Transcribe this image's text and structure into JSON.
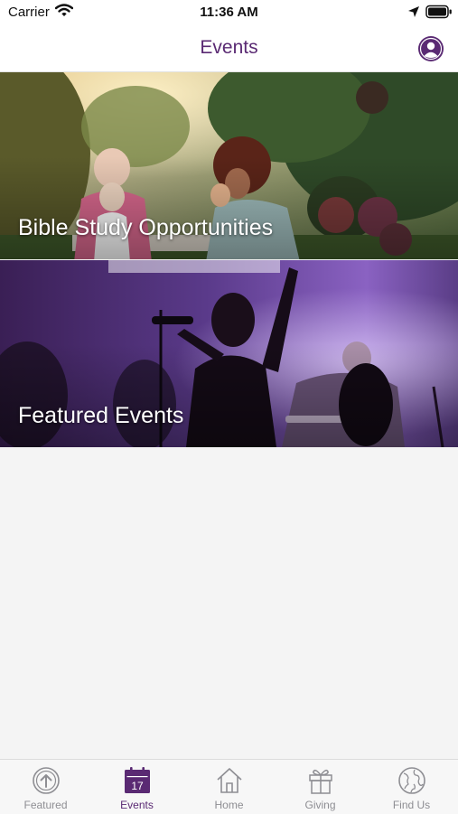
{
  "status_bar": {
    "carrier": "Carrier",
    "time": "11:36 AM"
  },
  "header": {
    "title": "Events",
    "profile_icon": "person-circle-icon"
  },
  "cards": [
    {
      "label": "Bible Study Opportunities",
      "image": "outdoor-gathering-photo"
    },
    {
      "label": "Featured Events",
      "image": "worship-concert-photo"
    }
  ],
  "tabs": [
    {
      "label": "Featured",
      "icon": "arrow-up-circle-icon",
      "active": false
    },
    {
      "label": "Events",
      "icon": "calendar-icon",
      "calendar_day": "17",
      "active": true
    },
    {
      "label": "Home",
      "icon": "house-icon",
      "active": false
    },
    {
      "label": "Giving",
      "icon": "gift-icon",
      "active": false
    },
    {
      "label": "Find Us",
      "icon": "globe-icon",
      "active": false
    }
  ],
  "colors": {
    "accent": "#5a2a73",
    "inactive": "#8e8e93",
    "background": "#f4f4f4"
  }
}
